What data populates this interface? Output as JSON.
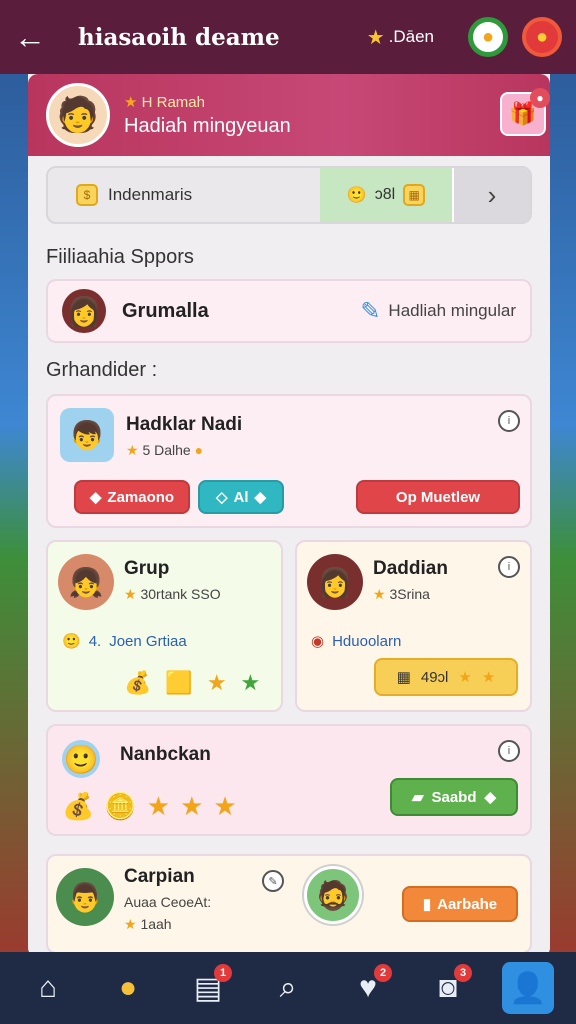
{
  "header": {
    "title": "hiasaoih deame",
    "rating": ".Dāen"
  },
  "profile": {
    "greeting": "H Ramah",
    "title": "Hadiah mingyeuan"
  },
  "summary": {
    "left_label": "Indenmaris",
    "mid_value": "ɔ8l"
  },
  "sections": {
    "friends_label": "Fiiliaahia Sppors",
    "groups_label": "Grhandider :"
  },
  "friend": {
    "name": "Grumalla",
    "right_label": "Hadliah mingular"
  },
  "card1": {
    "title": "Hadklar Nadi",
    "sub": "5 Dalhe",
    "btn_left": "Zamaono",
    "btn_mid": "Al",
    "btn_right": "Op Muetlew"
  },
  "card2": {
    "title": "Grup",
    "sub": "30rtank SSO",
    "row_num": "4.",
    "row_label": "Joen Grtiaa"
  },
  "card3": {
    "title": "Daddian",
    "sub": "3Srina",
    "row_label": "Hduoolarn",
    "pill_value": "49ɔl"
  },
  "card4": {
    "title": "Nanbckan",
    "btn": "Saabd"
  },
  "card5": {
    "title": "Carpian",
    "sub1": "Auaa CeoeAt:",
    "sub2": "1aah",
    "btn": "Aarbahe"
  },
  "nav": {
    "badge1": "1",
    "badge2": "2",
    "badge3": "3"
  }
}
